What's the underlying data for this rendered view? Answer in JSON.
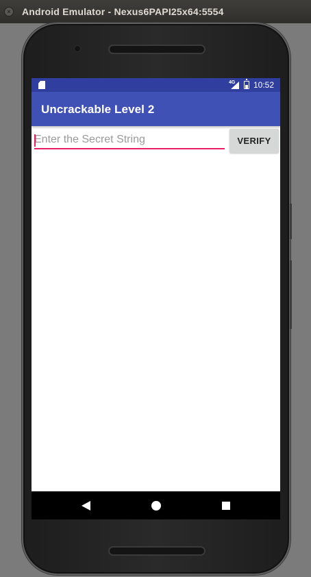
{
  "window": {
    "title": "Android Emulator - Nexus6PAPI25x64:5554",
    "close_icon": "×"
  },
  "status_bar": {
    "network": "4G",
    "time": "10:52",
    "icons": [
      "sd-card-icon",
      "signal-icon",
      "battery-icon"
    ]
  },
  "app_bar": {
    "title": "Uncrackable Level 2"
  },
  "form": {
    "input_value": "",
    "input_placeholder": "Enter the Secret String",
    "verify_label": "VERIFY"
  },
  "nav_bar": {
    "icons": [
      "back-icon",
      "home-icon",
      "recents-icon"
    ]
  },
  "colors": {
    "status_bar": "#303f9f",
    "app_bar": "#3f51b5",
    "accent": "#e91e63"
  }
}
